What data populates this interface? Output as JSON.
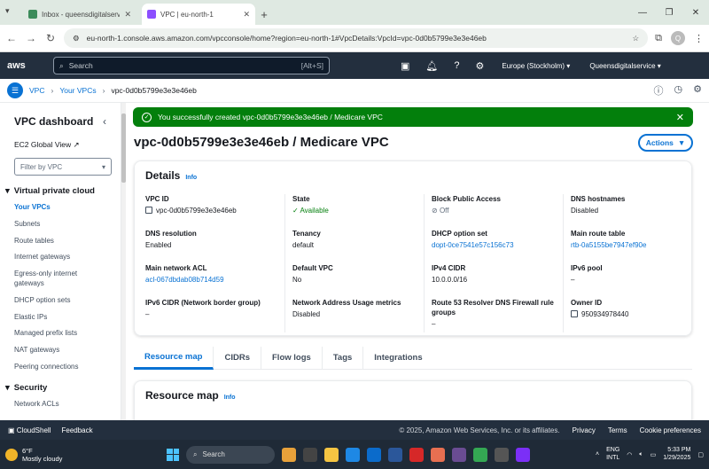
{
  "browser": {
    "tabs": [
      {
        "title": "Inbox - queensdigitalservices",
        "favicon_color": "#3c8b5a",
        "active": false
      },
      {
        "title": "VPC | eu-north-1",
        "favicon_color": "#8c4fff",
        "active": true
      }
    ],
    "new_tab": "+",
    "url": "eu-north-1.console.aws.amazon.com/vpcconsole/home?region=eu-north-1#VpcDetails:VpcId=vpc-0d0b5799e3e3e46eb",
    "profile_initial": "Q"
  },
  "aws": {
    "logo": "aws",
    "search_placeholder": "Search",
    "search_shortcut": "[Alt+S]",
    "region": "Europe (Stockholm) ▾",
    "account": "Queensdigitalservice ▾"
  },
  "breadcrumb": {
    "items": [
      "VPC",
      "Your VPCs",
      "vpc-0d0b5799e3e3e46eb"
    ],
    "sep": "›"
  },
  "sidebar": {
    "title": "VPC dashboard",
    "ec2_global_view": "EC2 Global View",
    "filter_placeholder": "Filter by VPC",
    "section": "Virtual private cloud",
    "items": [
      "Your VPCs",
      "Subnets",
      "Route tables",
      "Internet gateways",
      "Egress-only internet gateways",
      "DHCP option sets",
      "Elastic IPs",
      "Managed prefix lists",
      "NAT gateways",
      "Peering connections"
    ],
    "section2": "Security",
    "section2_first": "Network ACLs"
  },
  "flash": {
    "message": "You successfully created vpc-0d0b5799e3e3e46eb / Medicare VPC"
  },
  "page": {
    "title": "vpc-0d0b5799e3e3e46eb / Medicare VPC",
    "actions": "Actions"
  },
  "details": {
    "heading": "Details",
    "info": "Info",
    "columns": [
      [
        {
          "k": "VPC ID",
          "v": "vpc-0d0b5799e3e3e46eb",
          "style": "copy"
        },
        {
          "k": "DNS resolution",
          "v": "Enabled",
          "style": ""
        },
        {
          "k": "Main network ACL",
          "v": "acl-067dbdab08b714d59",
          "style": "link"
        },
        {
          "k": "IPv6 CIDR (Network border group)",
          "v": "–",
          "style": ""
        }
      ],
      [
        {
          "k": "State",
          "v": "Available",
          "style": "green"
        },
        {
          "k": "Tenancy",
          "v": "default",
          "style": ""
        },
        {
          "k": "Default VPC",
          "v": "No",
          "style": ""
        },
        {
          "k": "Network Address Usage metrics",
          "v": "Disabled",
          "style": ""
        }
      ],
      [
        {
          "k": "Block Public Access",
          "v": "Off",
          "style": "gray"
        },
        {
          "k": "DHCP option set",
          "v": "dopt-0ce7541e57c156c73",
          "style": "link"
        },
        {
          "k": "IPv4 CIDR",
          "v": "10.0.0.0/16",
          "style": ""
        },
        {
          "k": "Route 53 Resolver DNS Firewall rule groups",
          "v": "–",
          "style": ""
        }
      ],
      [
        {
          "k": "DNS hostnames",
          "v": "Disabled",
          "style": ""
        },
        {
          "k": "Main route table",
          "v": "rtb-0a5155be7947ef90e",
          "style": "link"
        },
        {
          "k": "IPv6 pool",
          "v": "–",
          "style": ""
        },
        {
          "k": "Owner ID",
          "v": "950934978440",
          "style": "copy"
        }
      ]
    ]
  },
  "tabs": [
    "Resource map",
    "CIDRs",
    "Flow logs",
    "Tags",
    "Integrations"
  ],
  "resource_map": {
    "heading": "Resource map",
    "info": "Info"
  },
  "footer": {
    "cloudshell": "CloudShell",
    "feedback": "Feedback",
    "copyright": "© 2025, Amazon Web Services, Inc. or its affiliates.",
    "privacy": "Privacy",
    "terms": "Terms",
    "cookies": "Cookie preferences"
  },
  "taskbar": {
    "temp": "6°F",
    "weather": "Mostly cloudy",
    "search": "Search",
    "lang1": "ENG",
    "lang2": "INTL",
    "time": "5:33 PM",
    "date": "1/29/2025"
  }
}
